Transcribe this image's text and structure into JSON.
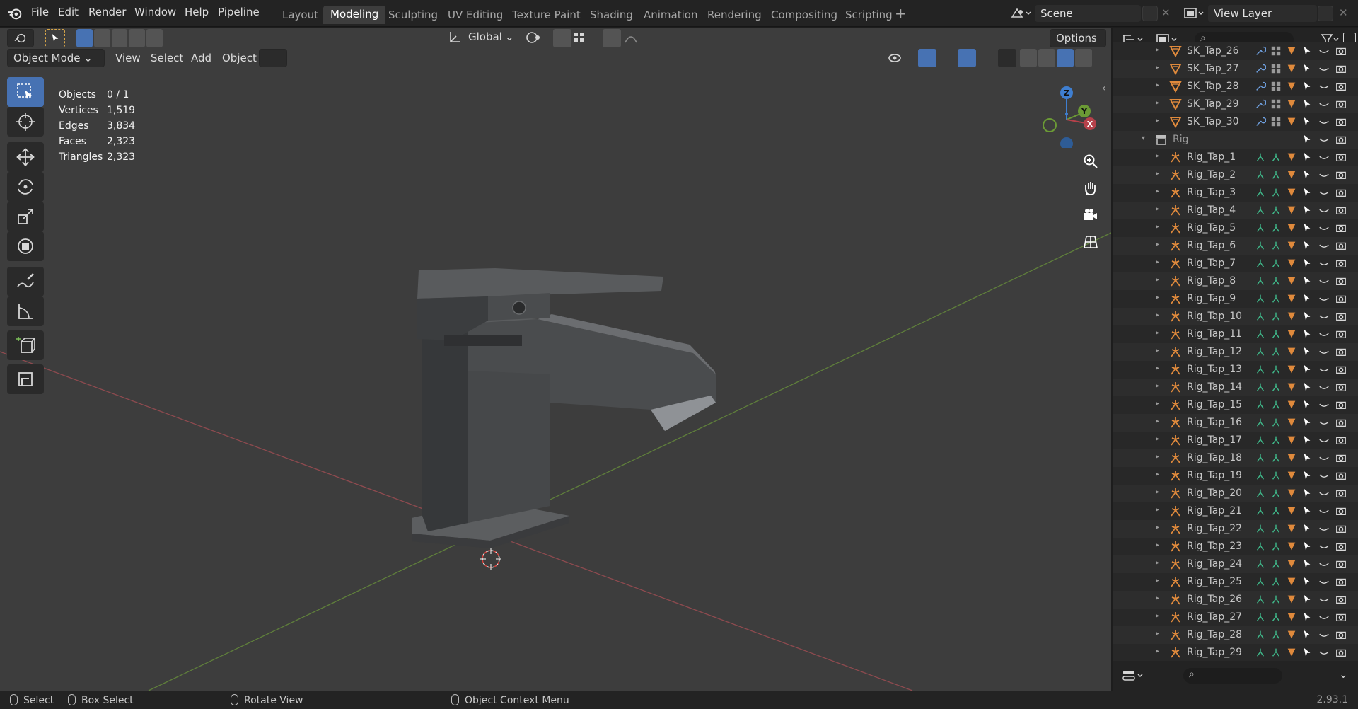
{
  "menu": [
    "File",
    "Edit",
    "Render",
    "Window",
    "Help",
    "Pipeline"
  ],
  "workspaces": [
    "Layout",
    "Modeling",
    "Sculpting",
    "UV Editing",
    "Texture Paint",
    "Shading",
    "Animation",
    "Rendering",
    "Compositing",
    "Scripting"
  ],
  "active_workspace": "Modeling",
  "scene": "Scene",
  "view_layer": "View Layer",
  "viewport": {
    "mode": "Object Mode",
    "menus": [
      "View",
      "Select",
      "Add",
      "Object"
    ],
    "transform_orientation": "Global",
    "options_label": "Options",
    "stats": [
      {
        "label": "Objects",
        "value": "0 / 1"
      },
      {
        "label": "Vertices",
        "value": "1,519"
      },
      {
        "label": "Edges",
        "value": "3,834"
      },
      {
        "label": "Faces",
        "value": "2,323"
      },
      {
        "label": "Triangles",
        "value": "2,323"
      }
    ],
    "gizmo_axes": [
      "Z",
      "Y",
      "X"
    ]
  },
  "outliner": {
    "collection": "Rig",
    "rows": [
      {
        "name": "SK_Tap_26",
        "type": "mesh"
      },
      {
        "name": "SK_Tap_27",
        "type": "mesh"
      },
      {
        "name": "SK_Tap_28",
        "type": "mesh"
      },
      {
        "name": "SK_Tap_29",
        "type": "mesh"
      },
      {
        "name": "SK_Tap_30",
        "type": "mesh"
      },
      {
        "name": "Rig",
        "type": "collection"
      },
      {
        "name": "Rig_Tap_1",
        "type": "armature"
      },
      {
        "name": "Rig_Tap_2",
        "type": "armature"
      },
      {
        "name": "Rig_Tap_3",
        "type": "armature"
      },
      {
        "name": "Rig_Tap_4",
        "type": "armature"
      },
      {
        "name": "Rig_Tap_5",
        "type": "armature"
      },
      {
        "name": "Rig_Tap_6",
        "type": "armature"
      },
      {
        "name": "Rig_Tap_7",
        "type": "armature"
      },
      {
        "name": "Rig_Tap_8",
        "type": "armature"
      },
      {
        "name": "Rig_Tap_9",
        "type": "armature"
      },
      {
        "name": "Rig_Tap_10",
        "type": "armature"
      },
      {
        "name": "Rig_Tap_11",
        "type": "armature"
      },
      {
        "name": "Rig_Tap_12",
        "type": "armature"
      },
      {
        "name": "Rig_Tap_13",
        "type": "armature"
      },
      {
        "name": "Rig_Tap_14",
        "type": "armature"
      },
      {
        "name": "Rig_Tap_15",
        "type": "armature"
      },
      {
        "name": "Rig_Tap_16",
        "type": "armature"
      },
      {
        "name": "Rig_Tap_17",
        "type": "armature"
      },
      {
        "name": "Rig_Tap_18",
        "type": "armature"
      },
      {
        "name": "Rig_Tap_19",
        "type": "armature"
      },
      {
        "name": "Rig_Tap_20",
        "type": "armature"
      },
      {
        "name": "Rig_Tap_21",
        "type": "armature"
      },
      {
        "name": "Rig_Tap_22",
        "type": "armature"
      },
      {
        "name": "Rig_Tap_23",
        "type": "armature"
      },
      {
        "name": "Rig_Tap_24",
        "type": "armature"
      },
      {
        "name": "Rig_Tap_25",
        "type": "armature"
      },
      {
        "name": "Rig_Tap_26",
        "type": "armature"
      },
      {
        "name": "Rig_Tap_27",
        "type": "armature"
      },
      {
        "name": "Rig_Tap_28",
        "type": "armature"
      },
      {
        "name": "Rig_Tap_29",
        "type": "armature"
      }
    ]
  },
  "statusbar": {
    "select": "Select",
    "box_select": "Box Select",
    "rotate_view": "Rotate View",
    "context_menu": "Object Context Menu",
    "version": "2.93.1"
  },
  "colors": {
    "accent": "#4772b3",
    "x_axis": "#b5414a",
    "y_axis": "#6b9a35",
    "z_axis": "#3f7fd1",
    "mesh_icon": "#e08a3c",
    "armature_icon": "#e08a3c",
    "bone_icon": "#3fb88a"
  }
}
